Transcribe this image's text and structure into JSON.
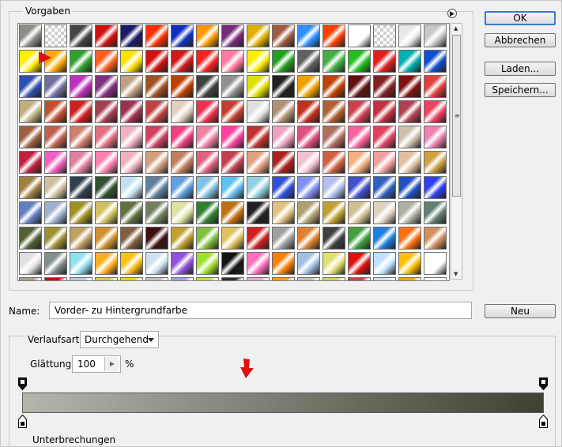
{
  "presets": {
    "legend": "Vorgaben",
    "columns": 17,
    "swatches": [
      [
        "#8e8e86",
        "#dddddd",
        "#444444",
        "#d01010",
        "#1a1a6a",
        "#ff3000",
        "#1030c0",
        "#ff9800",
        "#7a2a7a",
        "#e0b000",
        "#a05a40",
        "#3090ff",
        "#ff4000",
        "#ffffff",
        "#d8d8d8",
        "#e8e8e8",
        "#c8c8c8"
      ],
      [
        "#ffee00",
        "#ffaa00",
        "#30a030",
        "#ff6020",
        "#ffe000",
        "#d01010",
        "#d01818",
        "#ff2020",
        "#ff7aa0",
        "#ffee00",
        "#20a020",
        "#606060",
        "#40b040",
        "#20c020",
        "#e02020",
        "#00b0b0",
        "#1050d0"
      ],
      [
        "#3050b0",
        "#7070a0",
        "#c030c0",
        "#803080",
        "#c0a080",
        "#a05020",
        "#c04000",
        "#404040",
        "#909090",
        "#e0e000",
        "#202020",
        "#f0a000",
        "#c04000",
        "#601010",
        "#802020",
        "#801010",
        "#e04040"
      ],
      [
        "#c0b080",
        "#c05030",
        "#d02020",
        "#a04050",
        "#a03050",
        "#c04040",
        "#e0d0c0",
        "#f03050",
        "#c04030",
        "#e0e0e0",
        "#b09070",
        "#c03020",
        "#b06030",
        "#d04050",
        "#c03040",
        "#b04050",
        "#f04060"
      ],
      [
        "#a06040",
        "#c06050",
        "#d08070",
        "#e07080",
        "#f0b0c0",
        "#d04060",
        "#f04080",
        "#f080a0",
        "#ff40a0",
        "#c03030",
        "#f0a0c0",
        "#e05080",
        "#b07060",
        "#ff60a0",
        "#e04060",
        "#d0c0b0",
        "#f080b0"
      ],
      [
        "#c02040",
        "#f060c0",
        "#e080a0",
        "#ff80b0",
        "#f0b0c0",
        "#d0a080",
        "#c08060",
        "#e06080",
        "#c04050",
        "#e0a080",
        "#b02020",
        "#f0c0d0",
        "#d06040",
        "#f0b080",
        "#f0a0a0",
        "#e0c0a0",
        "#d0a040"
      ],
      [
        "#a08040",
        "#d0c0a0",
        "#304050",
        "#305030",
        "#c0e0f0",
        "#6080a0",
        "#60a0e0",
        "#80c0e0",
        "#60c0f0",
        "#90d0e0",
        "#3050e0",
        "#8090f0",
        "#b0c0f0",
        "#4050d0",
        "#3060c0",
        "#2050c0",
        "#3040f0"
      ],
      [
        "#6080c0",
        "#a0b0d0",
        "#a09020",
        "#d0c060",
        "#607040",
        "#708060",
        "#e0e0a0",
        "#308030",
        "#c07010",
        "#202020",
        "#e0c080",
        "#b0a070",
        "#c0a030",
        "#d0c090",
        "#e0d0c0",
        "#b0b0a0",
        "#608070"
      ],
      [
        "#506030",
        "#a09030",
        "#c0a060",
        "#d09030",
        "#806040",
        "#401010",
        "#c0a030",
        "#80c040",
        "#e0c060",
        "#d02020",
        "#a0a0a0",
        "#e08030",
        "#404040",
        "#40a040",
        "#2080e0",
        "#ff7010",
        "#d09060"
      ],
      [
        "#e0e0e0",
        "#809090",
        "#90e0f0",
        "#ffb020",
        "#ffc010",
        "#d0e0f0",
        "#9050e0",
        "#a0e030",
        "#151515",
        "#ff70c0",
        "#ff8000",
        "#a0c0e0",
        "#e0e070",
        "#e01010",
        "#c0e0ff",
        "#ffc000",
        "#ffffff"
      ],
      [
        "#b0a080",
        "#c01010",
        "#b0d0e0",
        "#e0c060",
        "#ffd010",
        "#c0c0c0",
        "#a0a0e0",
        "#c0e040",
        "#303030",
        "#ffa0d0",
        "#ffa000",
        "#c0c0c0",
        "#d0d060",
        "#d04040",
        "#d0e0f0",
        "#e0b000",
        "#ffffff"
      ]
    ]
  },
  "buttons": {
    "ok": "OK",
    "cancel": "Abbrechen",
    "load": "Laden...",
    "save": "Speichern...",
    "new": "Neu"
  },
  "name": {
    "label": "Name:",
    "value": "Vorder- zu Hintergrundfarbe"
  },
  "gradient_type": {
    "label": "Verlaufsart:",
    "value": "Durchgehend"
  },
  "smoothness": {
    "label": "Glättung:",
    "value": "100",
    "unit": "%"
  },
  "gradient": {
    "start_color": "#b4b6ac",
    "end_color": "#3f4134"
  },
  "section_partial": "Unterbrechungen",
  "colors": {
    "accent_border": "#3b79c9",
    "arrow_red": "#e01010"
  }
}
